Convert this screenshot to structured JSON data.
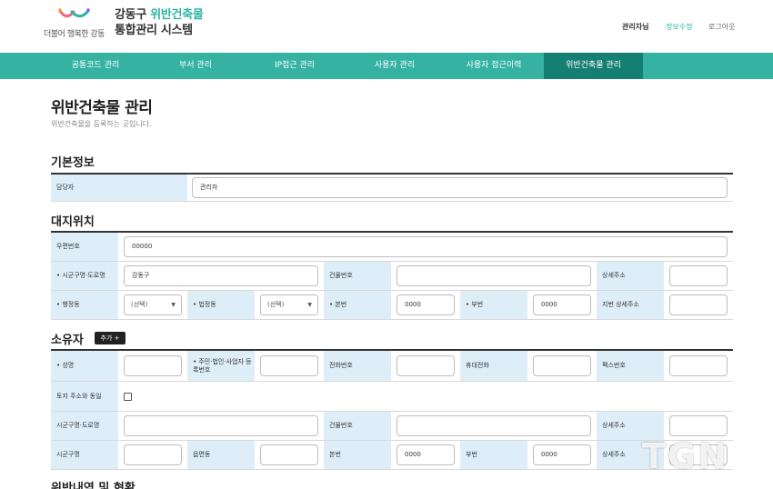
{
  "header": {
    "logo_slogan": "더불어 행복한 강동",
    "title_prefix": "강동구 ",
    "title_accent": "위반건축물",
    "title_line2": "통합관리 시스템",
    "admin_label": "관리자님",
    "info_edit": "정보수정",
    "logout": "로그아웃"
  },
  "nav": [
    "공통코드 관리",
    "부서 관리",
    "IP접근 관리",
    "사용자 관리",
    "사용자 접근이력",
    "위반건축물 관리"
  ],
  "page": {
    "title": "위반건축물 관리",
    "description": "위반건축물을 등록하는 곳입니다."
  },
  "basic": {
    "title": "기본정보",
    "manager_label": "담당자",
    "manager_value": "관리자"
  },
  "site": {
    "title": "대지위치",
    "postal_label": "우편번호",
    "postal_value": "00000",
    "addr_label": "• 시군구명·도로명",
    "addr_value": "강동구",
    "building_no_label": "건물번호",
    "detail_label": "상세주소",
    "admin_dong_label": "• 행정동",
    "admin_dong_value": "(선택)",
    "legal_dong_label": "• 법정동",
    "legal_dong_value": "(선택)",
    "main_no_label": "• 본번",
    "main_no_value": "0000",
    "sub_no_label": "• 부번",
    "sub_no_value": "0000",
    "lot_detail_label": "지번 상세주소"
  },
  "owner": {
    "title": "소유자",
    "add_button": "추가 +",
    "name_label": "• 성명",
    "reg_no_label": "• 주민·법인·사업자 등록번호",
    "phone_label": "전화번호",
    "mobile_label": "휴대전화",
    "fax_label": "팩스번호",
    "same_addr_label": "토지 주소와 동일",
    "road_label": "시군구명·도로명",
    "building_no_label": "건물번호",
    "detail_label": "상세주소",
    "city_label": "시군구명",
    "town_label": "읍면동",
    "main_no_label": "본번",
    "main_no_value": "0000",
    "sub_no_label": "부번",
    "sub_no_value": "0000",
    "detail2_label": "상세주소"
  },
  "violation": {
    "title": "위반내역 및 현황"
  },
  "watermark": "TGN",
  "colors": {
    "nav": "#35b2a2",
    "nav_active": "#167f74",
    "label_bg": "#ddeef9",
    "accent": "#2fb4a4"
  }
}
